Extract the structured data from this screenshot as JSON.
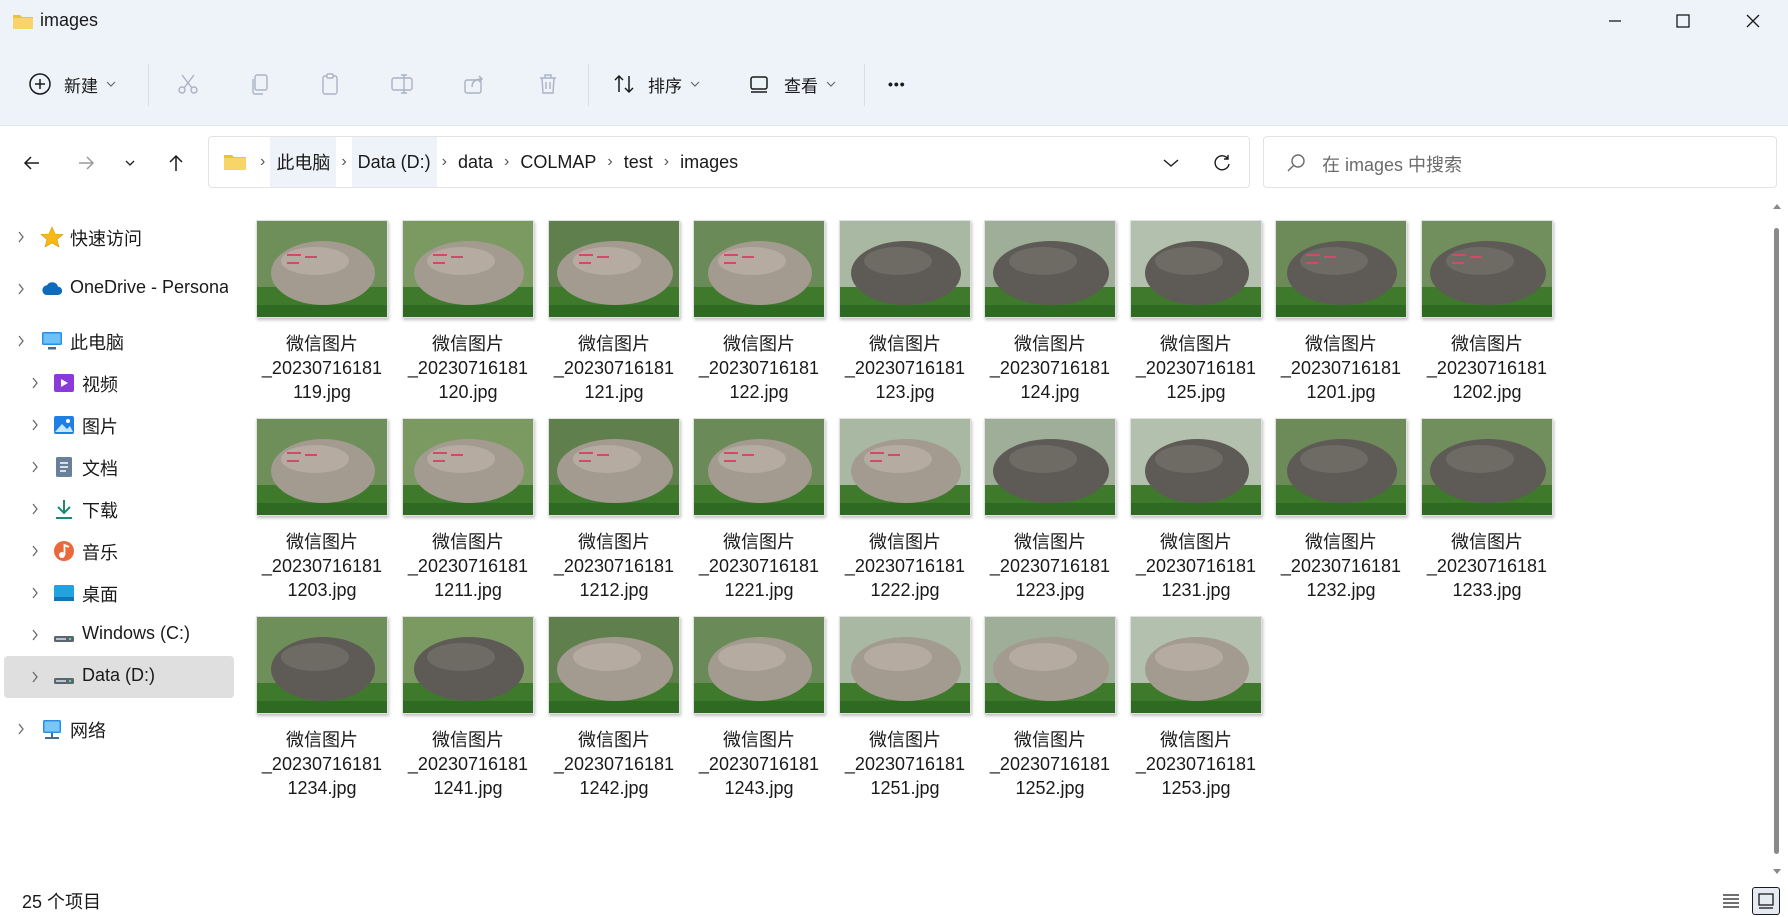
{
  "window": {
    "title": "images"
  },
  "toolbar": {
    "new_label": "新建",
    "sort_label": "排序",
    "view_label": "查看",
    "more_label": "•••"
  },
  "address": {
    "crumbs": [
      "此电脑",
      "Data (D:)",
      "data",
      "COLMAP",
      "test",
      "images"
    ]
  },
  "search": {
    "placeholder": "在 images 中搜索"
  },
  "sidebar": {
    "items": [
      {
        "label": "快速访问",
        "icon": "star-icon"
      },
      {
        "label": "OneDrive - Personal",
        "icon": "cloud-icon"
      },
      {
        "label": "此电脑",
        "icon": "monitor-icon"
      },
      {
        "label": "视频",
        "icon": "video-icon"
      },
      {
        "label": "图片",
        "icon": "pictures-icon"
      },
      {
        "label": "文档",
        "icon": "document-icon"
      },
      {
        "label": "下载",
        "icon": "download-icon"
      },
      {
        "label": "音乐",
        "icon": "music-icon"
      },
      {
        "label": "桌面",
        "icon": "desktop-icon"
      },
      {
        "label": "Windows (C:)",
        "icon": "drive-icon"
      },
      {
        "label": "Data (D:)",
        "icon": "drive-icon"
      },
      {
        "label": "网络",
        "icon": "network-icon"
      }
    ]
  },
  "files": [
    {
      "line1": "微信图片",
      "line2": "_20230716181",
      "line3": "119.jpg"
    },
    {
      "line1": "微信图片",
      "line2": "_20230716181",
      "line3": "120.jpg"
    },
    {
      "line1": "微信图片",
      "line2": "_20230716181",
      "line3": "121.jpg"
    },
    {
      "line1": "微信图片",
      "line2": "_20230716181",
      "line3": "122.jpg"
    },
    {
      "line1": "微信图片",
      "line2": "_20230716181",
      "line3": "123.jpg"
    },
    {
      "line1": "微信图片",
      "line2": "_20230716181",
      "line3": "124.jpg"
    },
    {
      "line1": "微信图片",
      "line2": "_20230716181",
      "line3": "125.jpg"
    },
    {
      "line1": "微信图片",
      "line2": "_20230716181",
      "line3": "1201.jpg"
    },
    {
      "line1": "微信图片",
      "line2": "_20230716181",
      "line3": "1202.jpg"
    },
    {
      "line1": "微信图片",
      "line2": "_20230716181",
      "line3": "1203.jpg"
    },
    {
      "line1": "微信图片",
      "line2": "_20230716181",
      "line3": "1211.jpg"
    },
    {
      "line1": "微信图片",
      "line2": "_20230716181",
      "line3": "1212.jpg"
    },
    {
      "line1": "微信图片",
      "line2": "_20230716181",
      "line3": "1221.jpg"
    },
    {
      "line1": "微信图片",
      "line2": "_20230716181",
      "line3": "1222.jpg"
    },
    {
      "line1": "微信图片",
      "line2": "_20230716181",
      "line3": "1223.jpg"
    },
    {
      "line1": "微信图片",
      "line2": "_20230716181",
      "line3": "1231.jpg"
    },
    {
      "line1": "微信图片",
      "line2": "_20230716181",
      "line3": "1232.jpg"
    },
    {
      "line1": "微信图片",
      "line2": "_20230716181",
      "line3": "1233.jpg"
    },
    {
      "line1": "微信图片",
      "line2": "_20230716181",
      "line3": "1234.jpg"
    },
    {
      "line1": "微信图片",
      "line2": "_20230716181",
      "line3": "1241.jpg"
    },
    {
      "line1": "微信图片",
      "line2": "_20230716181",
      "line3": "1242.jpg"
    },
    {
      "line1": "微信图片",
      "line2": "_20230716181",
      "line3": "1243.jpg"
    },
    {
      "line1": "微信图片",
      "line2": "_20230716181",
      "line3": "1251.jpg"
    },
    {
      "line1": "微信图片",
      "line2": "_20230716181",
      "line3": "1252.jpg"
    },
    {
      "line1": "微信图片",
      "line2": "_20230716181",
      "line3": "1253.jpg"
    }
  ],
  "status": {
    "count": "25 个项目"
  },
  "colors": {
    "chrome_bg": "#eef2f9",
    "selected_bg": "#dfdfdf",
    "folder_yellow": "#f2c037",
    "accent_blue": "#0067c0"
  }
}
